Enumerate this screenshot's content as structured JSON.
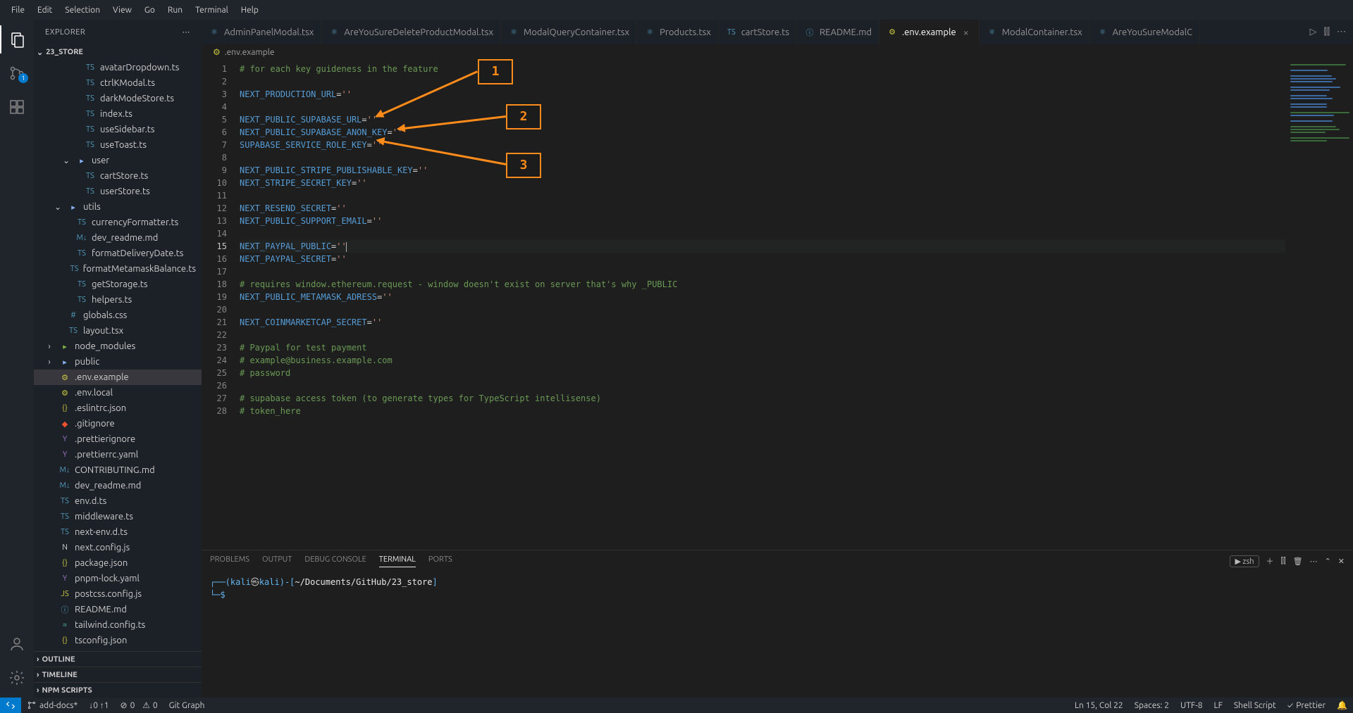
{
  "menubar": [
    "File",
    "Edit",
    "Selection",
    "View",
    "Go",
    "Run",
    "Terminal",
    "Help"
  ],
  "sidebar": {
    "title": "EXPLORER",
    "root": "23_STORE",
    "collapsed_sections": [
      "OUTLINE",
      "TIMELINE",
      "NPM SCRIPTS"
    ],
    "tree": [
      {
        "indent": 3,
        "icon": "ts",
        "label": "avatarDropdown.ts"
      },
      {
        "indent": 3,
        "icon": "ts",
        "label": "ctrlKModal.ts"
      },
      {
        "indent": 3,
        "icon": "ts",
        "label": "darkModeStore.ts"
      },
      {
        "indent": 3,
        "icon": "ts",
        "label": "index.ts"
      },
      {
        "indent": 3,
        "icon": "ts",
        "label": "useSidebar.ts"
      },
      {
        "indent": 3,
        "icon": "ts",
        "label": "useToast.ts"
      },
      {
        "indent": 2,
        "icon": "folder",
        "label": "user",
        "chev": "down"
      },
      {
        "indent": 3,
        "icon": "ts",
        "label": "cartStore.ts"
      },
      {
        "indent": 3,
        "icon": "ts",
        "label": "userStore.ts"
      },
      {
        "indent": 1,
        "icon": "folder",
        "label": "utils",
        "chev": "down"
      },
      {
        "indent": 2,
        "icon": "ts",
        "label": "currencyFormatter.ts"
      },
      {
        "indent": 2,
        "icon": "md",
        "label": "dev_readme.md"
      },
      {
        "indent": 2,
        "icon": "ts",
        "label": "formatDeliveryDate.ts"
      },
      {
        "indent": 2,
        "icon": "ts",
        "label": "formatMetamaskBalance.ts"
      },
      {
        "indent": 2,
        "icon": "ts",
        "label": "getStorage.ts"
      },
      {
        "indent": 2,
        "icon": "ts",
        "label": "helpers.ts"
      },
      {
        "indent": 1,
        "icon": "css",
        "label": "globals.css"
      },
      {
        "indent": 1,
        "icon": "ts",
        "label": "layout.tsx"
      },
      {
        "indent": 0,
        "icon": "folder-green",
        "label": "node_modules",
        "chev": "right"
      },
      {
        "indent": 0,
        "icon": "folder",
        "label": "public",
        "chev": "right"
      },
      {
        "indent": 0,
        "icon": "env",
        "label": ".env.example",
        "selected": true
      },
      {
        "indent": 0,
        "icon": "env",
        "label": ".env.local"
      },
      {
        "indent": 0,
        "icon": "json",
        "label": ".eslintrc.json"
      },
      {
        "indent": 0,
        "icon": "git",
        "label": ".gitignore"
      },
      {
        "indent": 0,
        "icon": "yaml",
        "label": ".prettierignore"
      },
      {
        "indent": 0,
        "icon": "yaml",
        "label": ".prettierrc.yaml"
      },
      {
        "indent": 0,
        "icon": "md",
        "label": "CONTRIBUTING.md"
      },
      {
        "indent": 0,
        "icon": "md",
        "label": "dev_readme.md"
      },
      {
        "indent": 0,
        "icon": "ts",
        "label": "env.d.ts"
      },
      {
        "indent": 0,
        "icon": "ts",
        "label": "middleware.ts"
      },
      {
        "indent": 0,
        "icon": "ts",
        "label": "next-env.d.ts"
      },
      {
        "indent": 0,
        "icon": "next",
        "label": "next.config.js"
      },
      {
        "indent": 0,
        "icon": "json",
        "label": "package.json"
      },
      {
        "indent": 0,
        "icon": "yaml",
        "label": "pnpm-lock.yaml"
      },
      {
        "indent": 0,
        "icon": "js",
        "label": "postcss.config.js"
      },
      {
        "indent": 0,
        "icon": "info",
        "label": "README.md"
      },
      {
        "indent": 0,
        "icon": "tail",
        "label": "tailwind.config.ts"
      },
      {
        "indent": 0,
        "icon": "json",
        "label": "tsconfig.json"
      }
    ]
  },
  "tabs": [
    {
      "icon": "react",
      "label": "AdminPanelModal.tsx"
    },
    {
      "icon": "react",
      "label": "AreYouSureDeleteProductModal.tsx"
    },
    {
      "icon": "react",
      "label": "ModalQueryContainer.tsx"
    },
    {
      "icon": "react",
      "label": "Products.tsx"
    },
    {
      "icon": "ts",
      "label": "cartStore.ts"
    },
    {
      "icon": "info",
      "label": "README.md"
    },
    {
      "icon": "env",
      "label": ".env.example",
      "active": true,
      "close": true
    },
    {
      "icon": "react",
      "label": "ModalContainer.tsx"
    },
    {
      "icon": "react",
      "label": "AreYouSureModalC"
    }
  ],
  "breadcrumb": {
    "icon": "env",
    "path": ".env.example"
  },
  "code": {
    "lines": [
      {
        "n": 1,
        "t": "comment",
        "text": "# for each key guideness in the feature"
      },
      {
        "n": 2,
        "t": "blank",
        "text": ""
      },
      {
        "n": 3,
        "t": "kv",
        "key": "NEXT_PRODUCTION_URL",
        "val": "''"
      },
      {
        "n": 4,
        "t": "blank",
        "text": ""
      },
      {
        "n": 5,
        "t": "kv",
        "key": "NEXT_PUBLIC_SUPABASE_URL",
        "val": "''"
      },
      {
        "n": 6,
        "t": "kv",
        "key": "NEXT_PUBLIC_SUPABASE_ANON_KEY",
        "val": "''"
      },
      {
        "n": 7,
        "t": "kv",
        "key": "SUPABASE_SERVICE_ROLE_KEY",
        "val": "''"
      },
      {
        "n": 8,
        "t": "blank",
        "text": ""
      },
      {
        "n": 9,
        "t": "kv",
        "key": "NEXT_PUBLIC_STRIPE_PUBLISHABLE_KEY",
        "val": "''"
      },
      {
        "n": 10,
        "t": "kv",
        "key": "NEXT_STRIPE_SECRET_KEY",
        "val": "''"
      },
      {
        "n": 11,
        "t": "blank",
        "text": ""
      },
      {
        "n": 12,
        "t": "kv",
        "key": "NEXT_RESEND_SECRET",
        "val": "''"
      },
      {
        "n": 13,
        "t": "kv",
        "key": "NEXT_PUBLIC_SUPPORT_EMAIL",
        "val": "''"
      },
      {
        "n": 14,
        "t": "blank",
        "text": ""
      },
      {
        "n": 15,
        "t": "kv",
        "key": "NEXT_PAYPAL_PUBLIC",
        "val": "''",
        "active": true,
        "cursor": true
      },
      {
        "n": 16,
        "t": "kv",
        "key": "NEXT_PAYPAL_SECRET",
        "val": "''"
      },
      {
        "n": 17,
        "t": "blank",
        "text": ""
      },
      {
        "n": 18,
        "t": "comment",
        "text": "# requires window.ethereum.request - window doesn't exist on server that's why _PUBLIC"
      },
      {
        "n": 19,
        "t": "kv",
        "key": "NEXT_PUBLIC_METAMASK_ADRESS",
        "val": "''"
      },
      {
        "n": 20,
        "t": "blank",
        "text": ""
      },
      {
        "n": 21,
        "t": "kv",
        "key": "NEXT_COINMARKETCAP_SECRET",
        "val": "''"
      },
      {
        "n": 22,
        "t": "blank",
        "text": ""
      },
      {
        "n": 23,
        "t": "comment",
        "text": "# Paypal for test payment"
      },
      {
        "n": 24,
        "t": "comment",
        "text": "# example@business.example.com"
      },
      {
        "n": 25,
        "t": "comment",
        "text": "# password"
      },
      {
        "n": 26,
        "t": "blank",
        "text": ""
      },
      {
        "n": 27,
        "t": "comment",
        "text": "# supabase access token (to generate types for TypeScript intellisense)"
      },
      {
        "n": 28,
        "t": "comment",
        "text": "# token_here"
      }
    ]
  },
  "annotations": {
    "box1": "1",
    "box2": "2",
    "box3": "3"
  },
  "panel": {
    "tabs": [
      "PROBLEMS",
      "OUTPUT",
      "DEBUG CONSOLE",
      "TERMINAL",
      "PORTS"
    ],
    "active": "TERMINAL",
    "shell": "zsh",
    "prompt": {
      "lead": "┌──(",
      "user": "kali",
      "at": "㉿",
      "host": "kali",
      "close": ")-[",
      "path": "~/Documents/GitHub/23_store",
      "end": "]",
      "line2_lead": "└─",
      "dollar": "$"
    }
  },
  "statusbar": {
    "branch": "add-docs*",
    "sync": "↓0 ↑1",
    "errors_icon": "⊘",
    "errors": "0",
    "warnings_icon": "⚠",
    "warnings": "0",
    "gitgraph": "Git Graph",
    "position": "Ln 15, Col 22",
    "spaces": "Spaces: 2",
    "encoding": "UTF-8",
    "eol": "LF",
    "lang": "Shell Script",
    "prettier": "Prettier",
    "bell": "🔔"
  },
  "colors": {
    "accent": "#ff8c1a"
  }
}
